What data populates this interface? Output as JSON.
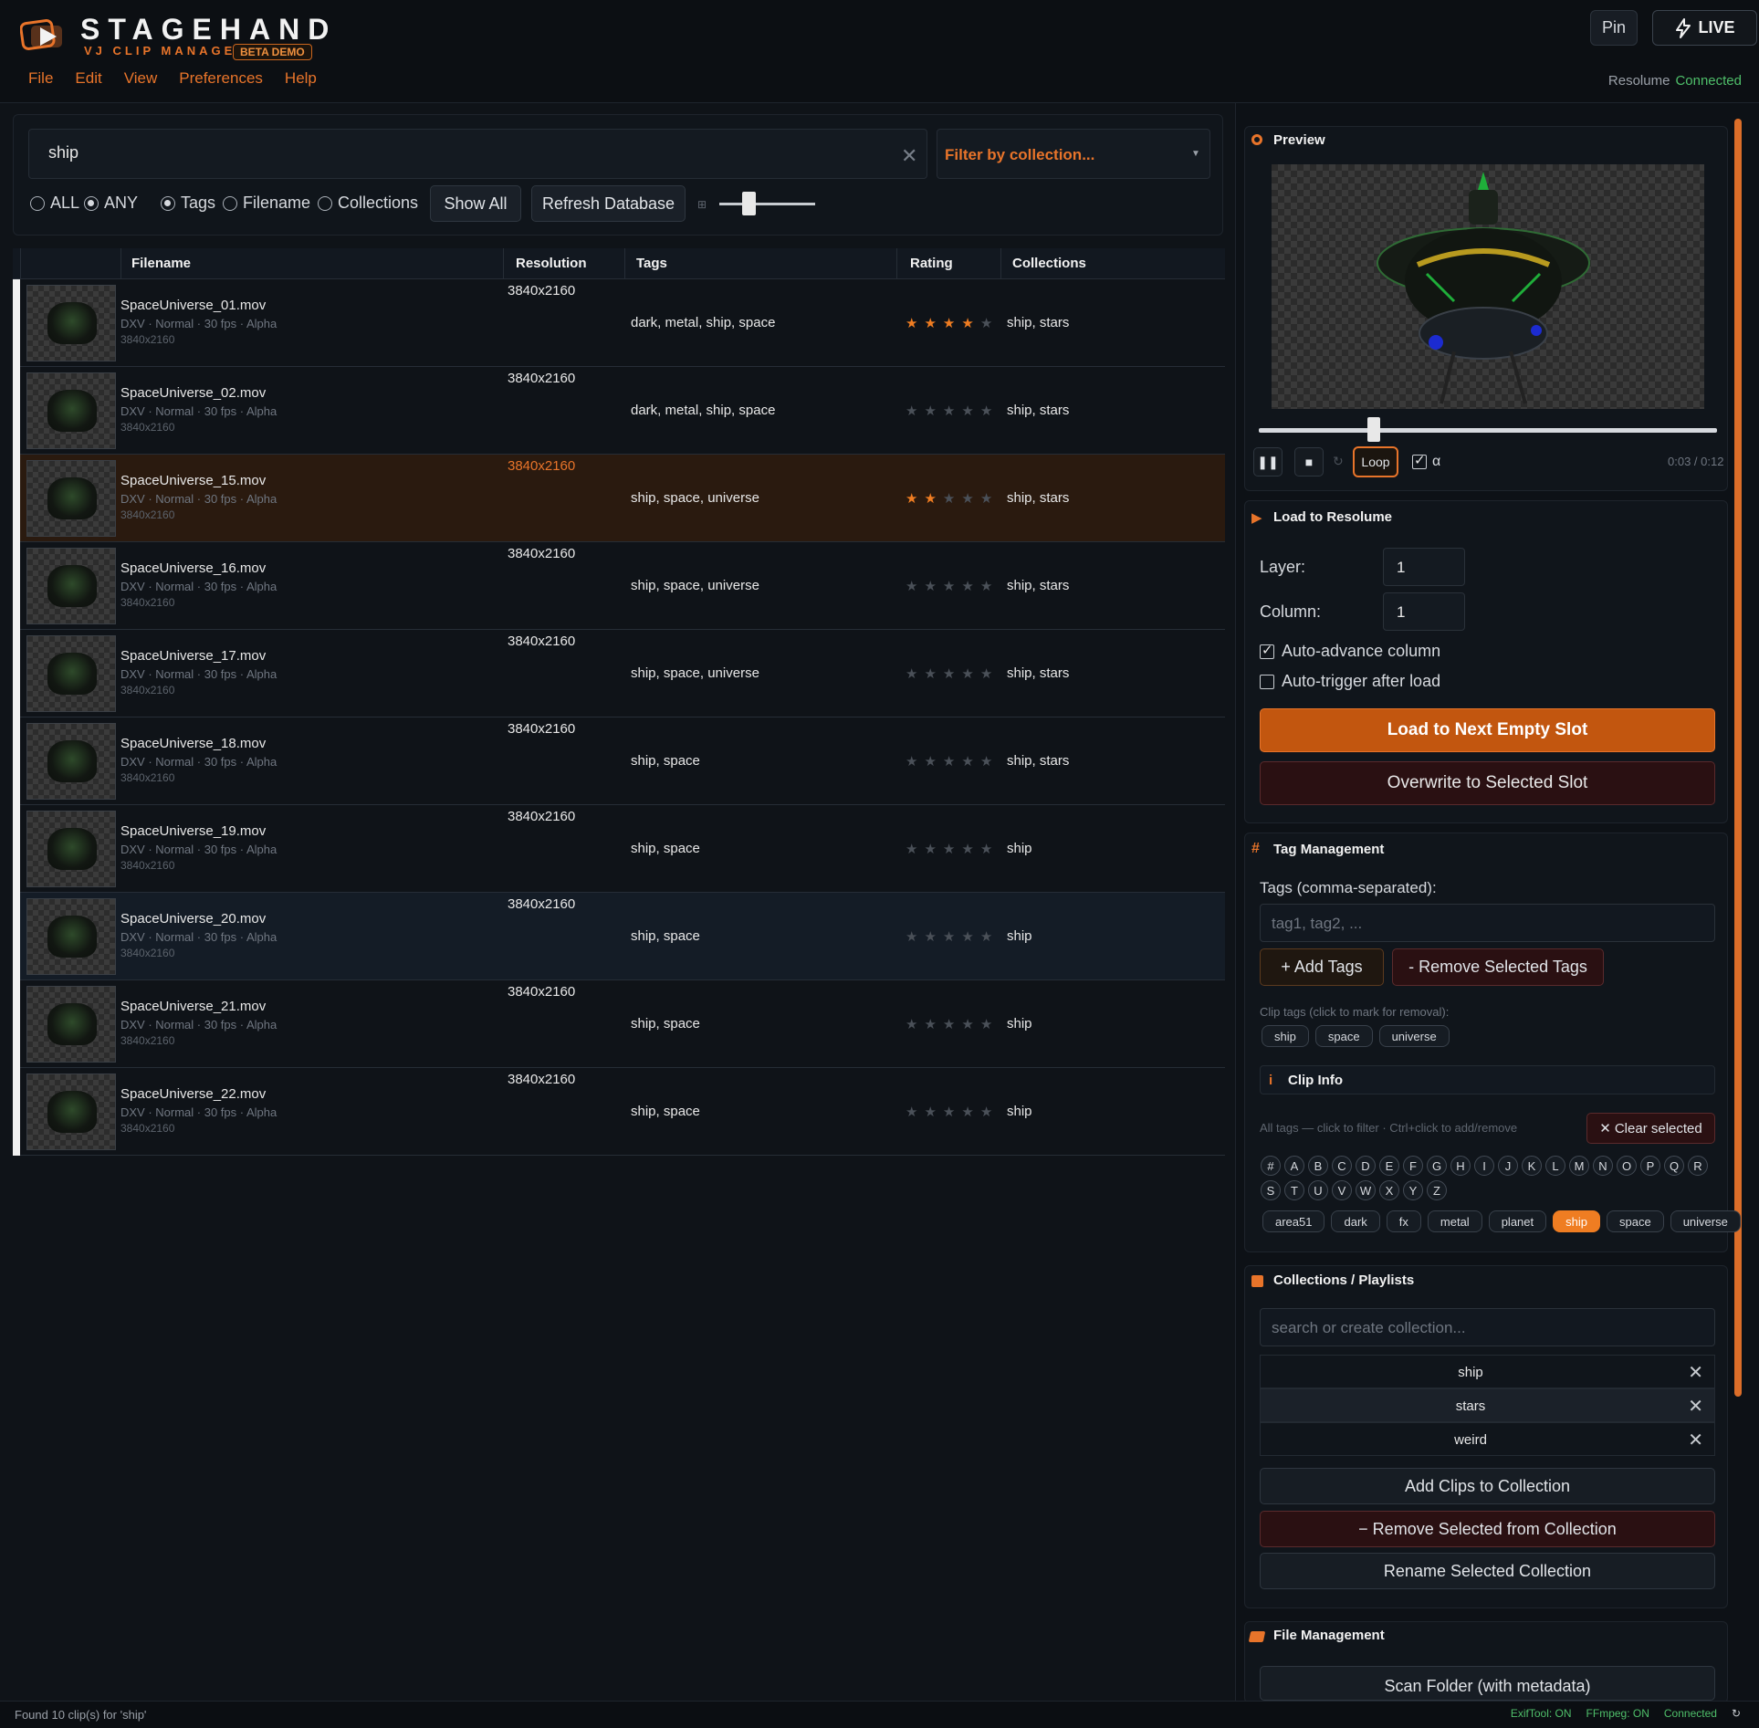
{
  "app": {
    "title": "STAGEHAND",
    "subtitle": "VJ CLIP MANAGER",
    "badge": "BETA DEMO",
    "menu": [
      "File",
      "Edit",
      "View",
      "Preferences",
      "Help"
    ],
    "pin_label": "Pin",
    "live_label": "LIVE",
    "resolume_label": "Resolume",
    "resolume_status": "Connected",
    "accent": "#e8742a"
  },
  "search": {
    "query": "ship",
    "collection_placeholder": "Filter by collection...",
    "match_mode": [
      "ALL",
      "ANY"
    ],
    "match_selected": "ANY",
    "fields": [
      "Tags",
      "Filename",
      "Collections"
    ],
    "field_selected": "Tags",
    "show_all_label": "Show All",
    "refresh_label": "Refresh Database",
    "thumb_size_value": 0.3
  },
  "table": {
    "headers": [
      "Filename",
      "Resolution",
      "Tags",
      "Rating",
      "Collections"
    ],
    "rows": [
      {
        "filename": "SpaceUniverse_01.mov",
        "meta": "DXV · Normal · 30 fps · Alpha",
        "res_small": "3840x2160",
        "resolution": "3840x2160",
        "tags": "dark, metal, ship, space",
        "rating": 4,
        "collections": "ship, stars"
      },
      {
        "filename": "SpaceUniverse_02.mov",
        "meta": "DXV · Normal · 30 fps · Alpha",
        "res_small": "3840x2160",
        "resolution": "3840x2160",
        "tags": "dark, metal, ship, space",
        "rating": 0,
        "collections": "ship, stars"
      },
      {
        "filename": "SpaceUniverse_15.mov",
        "meta": "DXV · Normal · 30 fps · Alpha",
        "res_small": "3840x2160",
        "resolution": "3840x2160",
        "tags": "ship, space, universe",
        "rating": 2,
        "collections": "ship, stars"
      },
      {
        "filename": "SpaceUniverse_16.mov",
        "meta": "DXV · Normal · 30 fps · Alpha",
        "res_small": "3840x2160",
        "resolution": "3840x2160",
        "tags": "ship, space, universe",
        "rating": 0,
        "collections": "ship, stars"
      },
      {
        "filename": "SpaceUniverse_17.mov",
        "meta": "DXV · Normal · 30 fps · Alpha",
        "res_small": "3840x2160",
        "resolution": "3840x2160",
        "tags": "ship, space, universe",
        "rating": 0,
        "collections": "ship, stars"
      },
      {
        "filename": "SpaceUniverse_18.mov",
        "meta": "DXV · Normal · 30 fps · Alpha",
        "res_small": "3840x2160",
        "resolution": "3840x2160",
        "tags": "ship, space",
        "rating": 0,
        "collections": "ship, stars"
      },
      {
        "filename": "SpaceUniverse_19.mov",
        "meta": "DXV · Normal · 30 fps · Alpha",
        "res_small": "3840x2160",
        "resolution": "3840x2160",
        "tags": "ship, space",
        "rating": 0,
        "collections": "ship"
      },
      {
        "filename": "SpaceUniverse_20.mov",
        "meta": "DXV · Normal · 30 fps · Alpha",
        "res_small": "3840x2160",
        "resolution": "3840x2160",
        "tags": "ship, space",
        "rating": 0,
        "collections": "ship"
      },
      {
        "filename": "SpaceUniverse_21.mov",
        "meta": "DXV · Normal · 30 fps · Alpha",
        "res_small": "3840x2160",
        "resolution": "3840x2160",
        "tags": "ship, space",
        "rating": 0,
        "collections": "ship"
      },
      {
        "filename": "SpaceUniverse_22.mov",
        "meta": "DXV · Normal · 30 fps · Alpha",
        "res_small": "3840x2160",
        "resolution": "3840x2160",
        "tags": "ship, space",
        "rating": 0,
        "collections": "ship"
      }
    ]
  },
  "preview": {
    "title": "Preview",
    "loop_label": "Loop",
    "alpha_label": "α",
    "time": "0:03 / 0:12",
    "progress": 0.25
  },
  "load": {
    "title": "Load to Resolume",
    "layer_label": "Layer:",
    "layer_value": "1",
    "column_label": "Column:",
    "column_value": "1",
    "auto_advance_label": "Auto-advance column",
    "auto_advance": true,
    "auto_trigger_label": "Auto-trigger after load",
    "auto_trigger": false,
    "load_next_label": "Load to Next Empty Slot",
    "overwrite_label": "Overwrite to Selected Slot"
  },
  "tags": {
    "title": "Tag Management",
    "input_label": "Tags (comma-separated):",
    "input_placeholder": "tag1, tag2, ...",
    "add_label": "+ Add Tags",
    "remove_label": "- Remove Selected Tags",
    "clip_tags_hint": "Clip tags (click to mark for removal):",
    "clip_tags": [
      "ship",
      "space",
      "universe"
    ],
    "info_title": "Clip Info",
    "all_tags_hint": "All tags — click to filter · Ctrl+click to add/remove",
    "clear_label": "Clear selected",
    "letters_row1": [
      "#",
      "A",
      "B",
      "C",
      "D",
      "E",
      "F",
      "G",
      "H",
      "I",
      "J",
      "K",
      "L",
      "M",
      "N",
      "O",
      "P",
      "Q",
      "R"
    ],
    "letters_row2": [
      "S",
      "T",
      "U",
      "V",
      "W",
      "X",
      "Y",
      "Z"
    ],
    "all_tags": [
      "area51",
      "dark",
      "fx",
      "metal",
      "planet",
      "ship",
      "space",
      "universe"
    ],
    "active_tag": "ship"
  },
  "collections": {
    "title": "Collections / Playlists",
    "search_placeholder": "search or create collection...",
    "items": [
      "ship",
      "stars",
      "weird"
    ],
    "add_label": "Add Clips to Collection",
    "remove_label": "− Remove Selected from Collection",
    "rename_label": "Rename Selected Collection"
  },
  "files": {
    "title": "File Management",
    "scan_label": "Scan Folder (with metadata)"
  },
  "status": {
    "left": "Found 10 clip(s) for 'ship'",
    "exiftool": "ExifTool: ON",
    "ffmpeg": "FFmpeg: ON",
    "connection": "Connected"
  }
}
